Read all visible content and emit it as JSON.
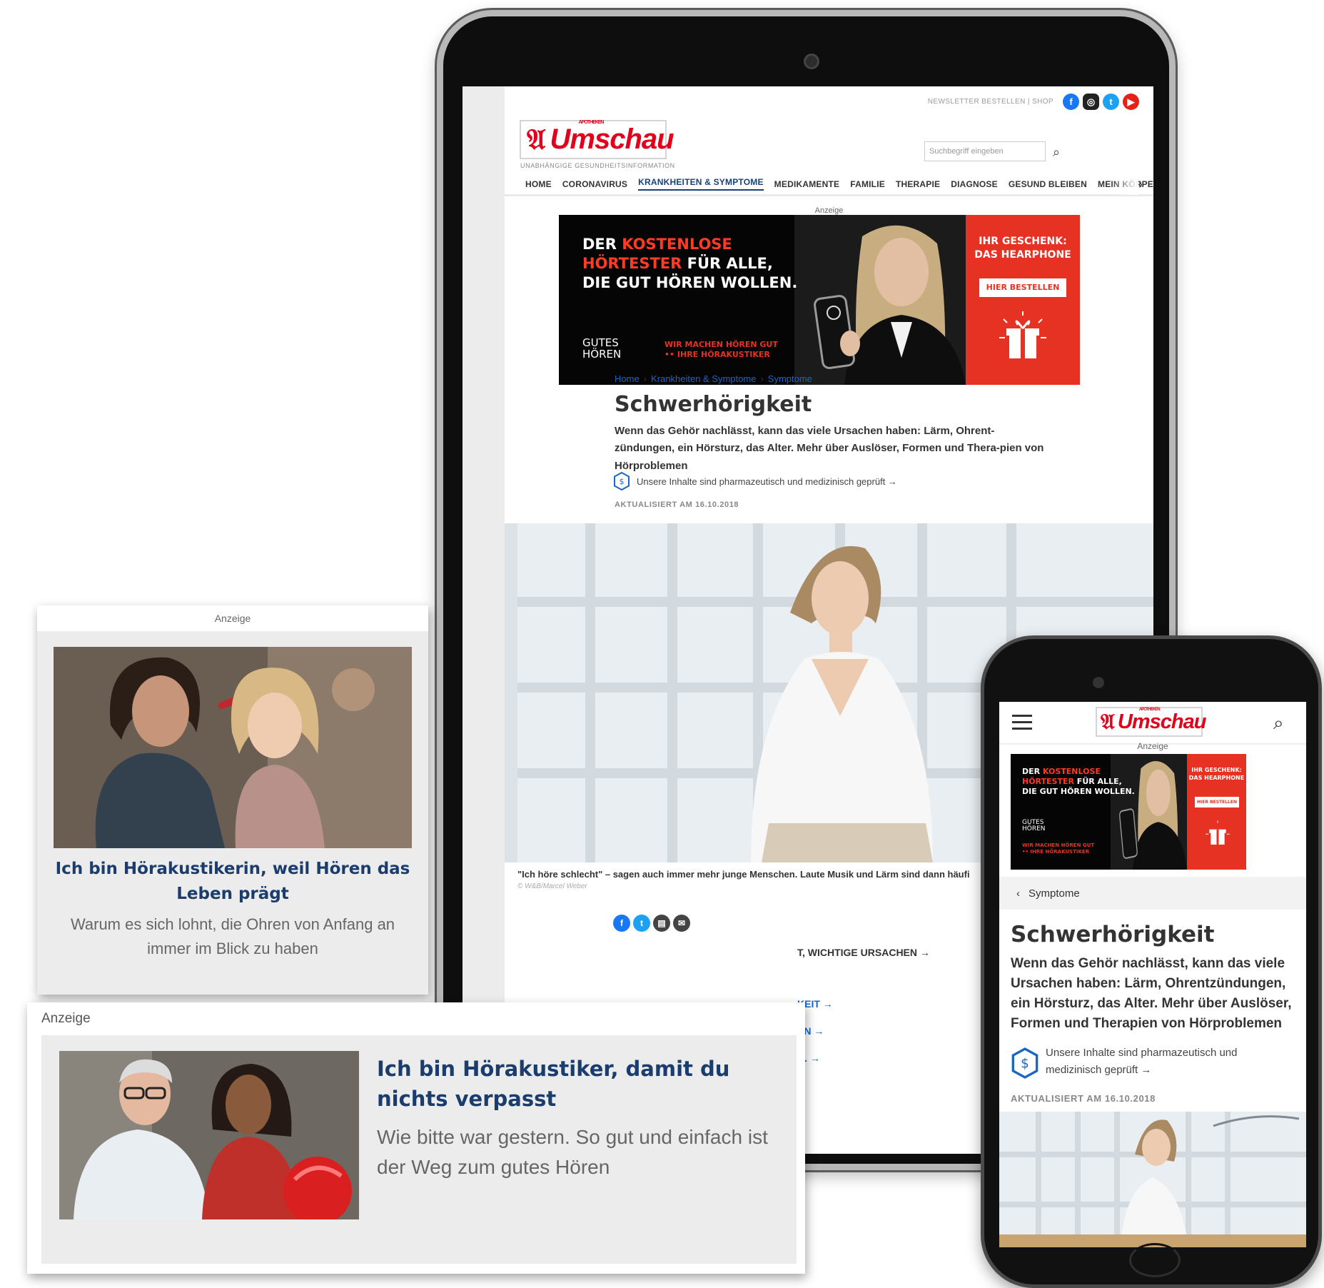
{
  "brand": {
    "logo_small": "APOTHEKEN",
    "logo_name": "Umschau",
    "tagline": "UNABHÄNGIGE GESUNDHEITSINFORMATION"
  },
  "top_links": "NEWSLETTER BESTELLEN  |  SHOP",
  "social": [
    "facebook-icon",
    "instagram-icon",
    "twitter-icon",
    "youtube-icon"
  ],
  "search": {
    "placeholder": "Suchbegriff eingeben"
  },
  "nav": [
    "HOME",
    "CORONAVIRUS",
    "KRANKHEITEN & SYMPTOME",
    "MEDIKAMENTE",
    "FAMILIE",
    "THERAPIE",
    "DIAGNOSE",
    "GESUND BLEIBEN",
    "MEIN KÖRPER"
  ],
  "nav_active": "KRANKHEITEN & SYMPTOME",
  "ad_label": "Anzeige",
  "banner": {
    "line1_a": "DER ",
    "line1_b": "KOSTENLOSE",
    "line2_a": "HÖRTESTER",
    "line2_b": " FÜR ALLE,",
    "line3": "DIE GUT HÖREN WOLLEN.",
    "gift_line1": "IHR GESCHENK:",
    "gift_line2": "DAS HEARPHONE",
    "button": "HIER BESTELLEN",
    "slogan1": "WIR MACHEN HÖREN GUT",
    "slogan2": "•• IHRE HÖRAKUSTIKER",
    "gh1": "GUTES",
    "gh2": "HÖREN"
  },
  "breadcrumbs": [
    "Home",
    "Krankheiten & Symptome",
    "Symptome"
  ],
  "article": {
    "title": "Schwerhörigkeit",
    "lead_tablet": "Wenn das Gehör nachlässt, kann das viele Ursachen haben: Lärm, Ohrent-zündungen, ein Hörsturz, das Alter. Mehr über Auslöser, Formen und Thera-pien von Hörproblemen",
    "lead_phone": "Wenn das Gehör nachlässt, kann das viele Ursachen haben: Lärm, Ohrentzündungen, ein Hörsturz, das Alter. Mehr über Auslöser, Formen und Therapien von Hörproblemen",
    "check": "Unsere Inhalte sind pharmazeutisch und medizinisch geprüft →",
    "updated": "AKTUALISIERT AM 16.10.2018",
    "caption": "\"Ich höre schlecht\" – sagen auch immer mehr junge Menschen. Laute Musik und Lärm sind dann häufi",
    "credit": "© W&B/Marcel Weber",
    "share": [
      "facebook-icon",
      "twitter-icon",
      "print-icon",
      "mail-icon"
    ],
    "partial_links": [
      "T, WICHTIGE URSACHEN →",
      "KEIT →",
      "EN →",
      "N. →"
    ]
  },
  "phone_back": "Symptome",
  "ad_card_1": {
    "label": "Anzeige",
    "title": "Ich bin Hörakustikerin, weil Hören das Leben prägt",
    "text": "Warum es sich lohnt, die Ohren von Anfang an immer im Blick zu haben"
  },
  "ad_card_2": {
    "label": "Anzeige",
    "title": "Ich bin Hörakustiker, damit du nichts verpasst",
    "text": "Wie bitte war gestern. So gut und einfach ist der Weg zum gutes Hören"
  },
  "colors": {
    "brand_red": "#e2001a",
    "link_blue": "#1a66c4",
    "ad_title_blue": "#1a3d6d",
    "banner_red": "#e63222"
  }
}
